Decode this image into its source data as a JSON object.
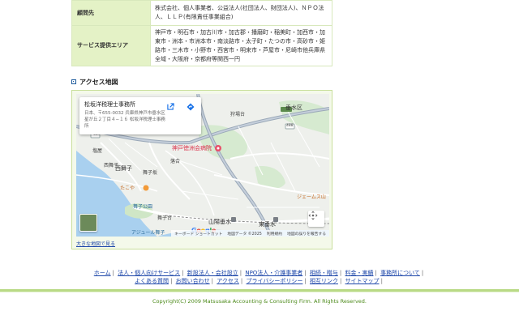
{
  "table": {
    "rows": [
      {
        "header": "顧問先",
        "value": "株式会社、個人事業者、公益法人(社団法人、財団法人)、ＮＰＯ法人、ＬＬＰ(有限責任事業組合)"
      },
      {
        "header": "サービス提供エリア",
        "value": "神戸市・明石市・加古川市・加古郡・播磨町・稲美町・加西市・加東市・洲本・市洲本市・南淡路市・太子町・たつの市・高砂市・姫路市・三木市・小野市・西宮市・明来市・芦屋市・尼崎市他兵庫県全域・大阪府・京都府等関西一円"
      }
    ]
  },
  "access": {
    "title": "アクセス地図",
    "big_map_link": "大きな地図で見る"
  },
  "map": {
    "place_name": "松坂洋税理士事務所",
    "address": "日本、〒655-0032 兵庫県神戸市垂水区星が丘２丁目４−１６ 松坂洋税理士事務所",
    "labels": {
      "tarumi": "垂水区",
      "nishimaiko": "西舞子",
      "maiko_tsubo": "舞子坂",
      "nishi_maiko2": "西舞子",
      "maiko_kouen": "舞子公園",
      "hospital": "神戸徳洲会病院",
      "ochiya": "落合",
      "tako": "たこや",
      "hyogo_kenritsu": "兵庫県立\n舞子公園",
      "sanyo_tarumi": "山陽垂水",
      "higashi_tarumi": "東垂水",
      "james": "ジェームス山",
      "kinmokusei": "狩場台",
      "maiko_dai": "舞子台",
      "azur": "アジュール舞子",
      "gakugaoka": "学が丘",
      "kuma": "塩屋",
      "road_488": "488",
      "road_487": "487",
      "road_21": "21",
      "road_2": "2"
    },
    "attribution": {
      "shortcuts": "キーボード ショートカット",
      "data": "地図データ ©2025",
      "terms": "利用規約",
      "report": "地図の誤りを報告する"
    },
    "google": [
      "G",
      "o",
      "o",
      "g",
      "l",
      "e"
    ],
    "google_colors": [
      "#4285f4",
      "#ea4335",
      "#fbbc05",
      "#4285f4",
      "#34a853",
      "#ea4335"
    ]
  },
  "footer": {
    "nav_line1": [
      "ホーム",
      "法人・個人向けサービス",
      "新設法人・会社設立",
      "NPO法人・介護事業者",
      "相続・贈与",
      "料金・実績",
      "事務所について"
    ],
    "nav_line2": [
      "よくある質問",
      "お問い合わせ",
      "アクセス",
      "プライバシーポリシー",
      "相互リンク",
      "サイトマップ"
    ],
    "copyright": "Copyright(C) 2009 Matsusaka Accounting & Consulting Firm. All Rights Reserved."
  }
}
